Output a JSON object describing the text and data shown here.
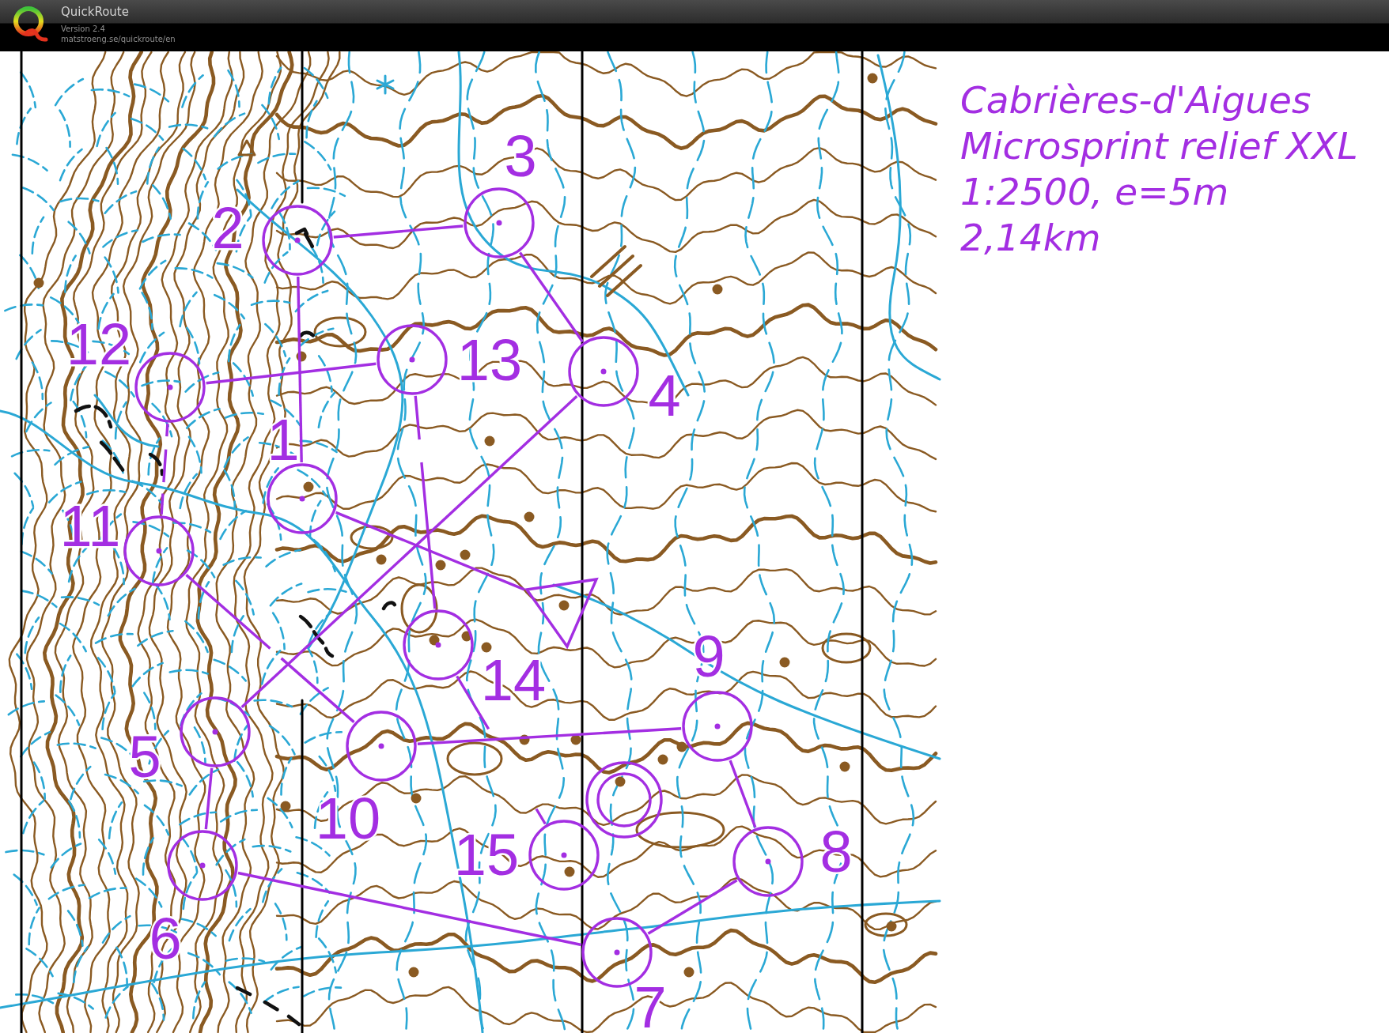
{
  "window": {
    "title": "QuickRoute",
    "version": "Version 2.4",
    "url": "matstroeng.se/quickroute/en"
  },
  "course": {
    "points": [
      {
        "kind": "start"
      },
      {
        "kind": "control",
        "number": "1"
      },
      {
        "kind": "control",
        "number": "2"
      },
      {
        "kind": "control",
        "number": "3"
      },
      {
        "kind": "control",
        "number": "4"
      },
      {
        "kind": "control",
        "number": "5"
      },
      {
        "kind": "control",
        "number": "6"
      },
      {
        "kind": "control",
        "number": "7"
      },
      {
        "kind": "control",
        "number": "8"
      },
      {
        "kind": "control",
        "number": "9"
      },
      {
        "kind": "control",
        "number": "10"
      },
      {
        "kind": "control",
        "number": "11"
      },
      {
        "kind": "control",
        "number": "12"
      },
      {
        "kind": "control",
        "number": "13"
      },
      {
        "kind": "control",
        "number": "14"
      },
      {
        "kind": "control",
        "number": "15"
      },
      {
        "kind": "finish"
      }
    ]
  },
  "legend": {
    "lines": [
      "Cabrières-d'Aigues",
      "Microsprint relief XXL",
      "1:2500, e=5m",
      "2,14km"
    ]
  }
}
